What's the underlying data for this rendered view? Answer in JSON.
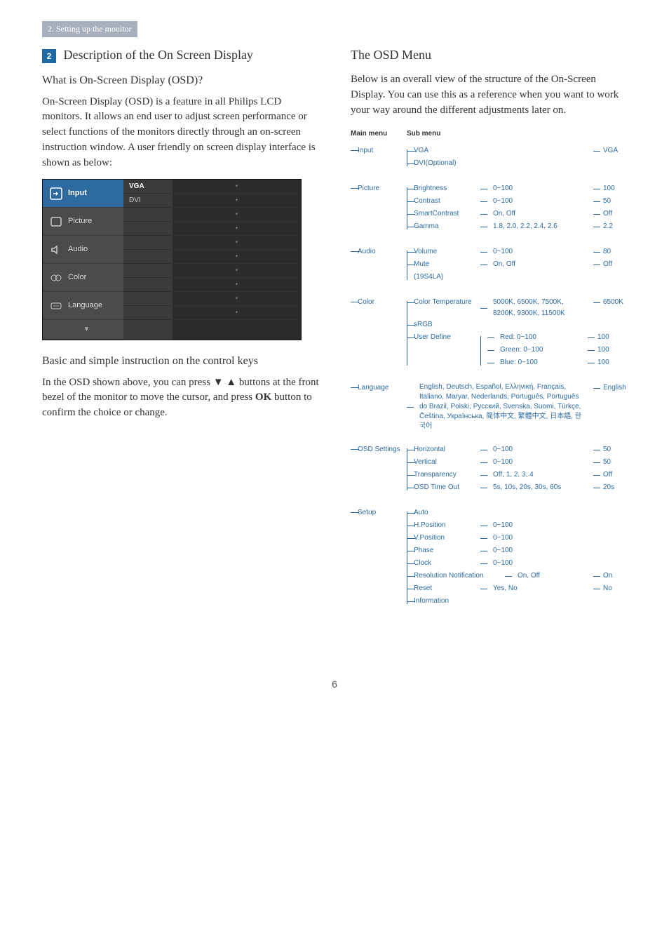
{
  "breadcrumb": "2. Setting up the monitor",
  "page_number": "6",
  "left": {
    "section_num": "2",
    "heading": "Description of the On Screen Display",
    "q_heading": "What is On-Screen Display (OSD)?",
    "intro": "On-Screen Display (OSD) is a feature in all Philips LCD monitors. It allows an end user to adjust screen performance or select functions of the monitors directly through an on-screen instruction window. A user friendly on screen display interface is shown as below:",
    "osd": {
      "items": [
        "Input",
        "Picture",
        "Audio",
        "Color",
        "Language"
      ],
      "mid": [
        "VGA",
        "DVI"
      ]
    },
    "keys_heading": "Basic and simple instruction on the control keys",
    "keys_text_1": "In the OSD shown above, you can press ▼ ▲ buttons at the front bezel of the monitor to move the cursor, and press ",
    "keys_ok": "OK",
    "keys_text_2": " button to confirm the choice or change."
  },
  "right": {
    "heading": "The OSD Menu",
    "intro": "Below is an overall view of the structure of the On-Screen Display. You can use this as a reference when you want to work your way around the different adjustments later on.",
    "th_main": "Main menu",
    "th_sub": "Sub menu",
    "tree": {
      "input": {
        "label": "Input",
        "items": [
          {
            "label": "VGA"
          },
          {
            "label": "DVI(Optional)"
          }
        ],
        "val": "VGA"
      },
      "picture": {
        "label": "Picture",
        "items": [
          {
            "label": "Brightness",
            "opts": "0~100",
            "val": "100"
          },
          {
            "label": "Contrast",
            "opts": "0~100",
            "val": "50"
          },
          {
            "label": "SmartContrast",
            "opts": "On, Off",
            "val": "Off"
          },
          {
            "label": "Gamma",
            "opts": "1.8, 2.0, 2.2, 2.4, 2.6",
            "val": "2.2"
          }
        ]
      },
      "audio": {
        "label": "Audio",
        "items": [
          {
            "label": "Volume",
            "opts": "0~100",
            "val": "80"
          },
          {
            "label": "Mute",
            "opts": "On, Off",
            "val": "Off"
          }
        ],
        "note": "(19S4LA)"
      },
      "color": {
        "label": "Color",
        "items": [
          {
            "label": "Color Temperature",
            "opts": "5000K, 6500K, 7500K, 8200K, 9300K, 11500K",
            "val": "6500K"
          },
          {
            "label": "sRGB"
          },
          {
            "label": "User Define",
            "sub": [
              {
                "label": "Red: 0~100",
                "val": "100"
              },
              {
                "label": "Green: 0~100",
                "val": "100"
              },
              {
                "label": "Blue: 0~100",
                "val": "100"
              }
            ]
          }
        ]
      },
      "language": {
        "label": "Language",
        "opts": "English, Deutsch, Español, Ελληνική, Français, Italiano, Maryar, Nederlands, Português, Português do Brazil, Polski, Русский, Svenska, Suomi, Türkçe, Čeština, Українська, 简体中文, 繁體中文, 日本語, 한국어",
        "val": "English"
      },
      "osdsettings": {
        "label": "OSD Settings",
        "items": [
          {
            "label": "Horizontal",
            "opts": "0~100",
            "val": "50"
          },
          {
            "label": "Vertical",
            "opts": "0~100",
            "val": "50"
          },
          {
            "label": "Transparency",
            "opts": "Off, 1, 2, 3, 4",
            "val": "Off"
          },
          {
            "label": "OSD Time Out",
            "opts": "5s, 10s, 20s, 30s, 60s",
            "val": "20s"
          }
        ]
      },
      "setup": {
        "label": "Setup",
        "items": [
          {
            "label": "Auto"
          },
          {
            "label": "H.Position",
            "opts": "0~100"
          },
          {
            "label": "V.Position",
            "opts": "0~100"
          },
          {
            "label": "Phase",
            "opts": "0~100"
          },
          {
            "label": "Clock",
            "opts": "0~100"
          },
          {
            "label": "Resolution Notification",
            "opts": "On, Off",
            "val": "On"
          },
          {
            "label": "Reset",
            "opts": "Yes, No",
            "val": "No"
          },
          {
            "label": "Information"
          }
        ]
      }
    }
  }
}
